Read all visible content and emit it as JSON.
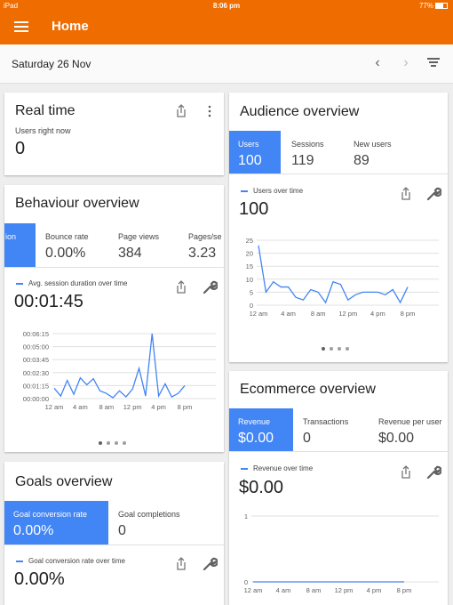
{
  "status_bar": {
    "device": "iPad",
    "time": "8:06 pm",
    "battery": "77%"
  },
  "app_bar": {
    "title": "Home"
  },
  "date_bar": {
    "date": "Saturday 26 Nov"
  },
  "realtime": {
    "title": "Real time",
    "label": "Users right now",
    "value": "0"
  },
  "behaviour": {
    "title": "Behaviour overview",
    "tabs": [
      {
        "label": "ion",
        "value": ""
      },
      {
        "label": "Bounce rate",
        "value": "0.00%"
      },
      {
        "label": "Page views",
        "value": "384"
      },
      {
        "label": "Pages/se",
        "value": "3.23"
      }
    ],
    "legend": "Avg. session duration over time",
    "big_value": "00:01:45",
    "chart_data": {
      "type": "line",
      "ylabels": [
        "00:06:15",
        "00:05:00",
        "00:03:45",
        "00:02:30",
        "00:01:15",
        "00:00:00"
      ],
      "yticks": [
        375,
        300,
        225,
        150,
        75,
        0
      ],
      "ylim": [
        0,
        375
      ],
      "xlabels": [
        "12 am",
        "4 am",
        "8 am",
        "12 pm",
        "4 pm",
        "8 pm"
      ],
      "x": [
        0,
        1,
        2,
        3,
        4,
        5,
        6,
        7,
        8,
        9,
        10,
        11,
        12,
        13,
        14,
        15,
        16,
        17,
        18,
        19,
        20
      ],
      "xticks": [
        0,
        4,
        8,
        12,
        16,
        20
      ],
      "values": [
        60,
        15,
        105,
        25,
        120,
        80,
        115,
        45,
        30,
        5,
        45,
        10,
        55,
        175,
        15,
        375,
        15,
        85,
        10,
        30,
        75
      ]
    }
  },
  "goals": {
    "title": "Goals overview",
    "tabs": [
      {
        "label": "Goal conversion rate",
        "value": "0.00%"
      },
      {
        "label": "Goal completions",
        "value": "0"
      }
    ],
    "legend": "Goal conversion rate over time",
    "big_value": "0.00%"
  },
  "audience": {
    "title": "Audience overview",
    "tabs": [
      {
        "label": "Users",
        "value": "100"
      },
      {
        "label": "Sessions",
        "value": "119"
      },
      {
        "label": "New users",
        "value": "89"
      }
    ],
    "legend": "Users over time",
    "big_value": "100",
    "chart_data": {
      "type": "line",
      "ylabels": [
        "25",
        "20",
        "15",
        "10",
        "5",
        "0"
      ],
      "yticks": [
        25,
        20,
        15,
        10,
        5,
        0
      ],
      "ylim": [
        0,
        25
      ],
      "xlabels": [
        "12 am",
        "4 am",
        "8 am",
        "12 pm",
        "4 pm",
        "8 pm"
      ],
      "x": [
        0,
        1,
        2,
        3,
        4,
        5,
        6,
        7,
        8,
        9,
        10,
        11,
        12,
        13,
        14,
        15,
        16,
        17,
        18,
        19,
        20
      ],
      "xticks": [
        0,
        4,
        8,
        12,
        16,
        20
      ],
      "values": [
        23,
        5,
        9,
        7,
        7,
        3,
        2,
        6,
        5,
        1,
        9,
        8,
        2,
        4,
        5,
        5,
        5,
        4,
        6,
        1,
        7
      ]
    }
  },
  "ecommerce": {
    "title": "Ecommerce overview",
    "tabs": [
      {
        "label": "Revenue",
        "value": "$0.00"
      },
      {
        "label": "Transactions",
        "value": "0"
      },
      {
        "label": "Revenue per user",
        "value": "$0.00"
      }
    ],
    "legend": "Revenue over time",
    "big_value": "$0.00",
    "chart_data": {
      "type": "line",
      "ylabels": [
        "1",
        "0"
      ],
      "yticks": [
        1,
        0
      ],
      "ylim": [
        0,
        1
      ],
      "xlabels": [
        "12 am",
        "4 am",
        "8 am",
        "12 pm",
        "4 pm",
        "8 pm"
      ],
      "x": [
        0,
        20
      ],
      "xticks": [
        0,
        4,
        8,
        12,
        16,
        20
      ],
      "values": [
        0,
        0
      ]
    }
  },
  "colors": {
    "brand": "#ef6c00",
    "accent": "#4285f4"
  },
  "icons": [
    "menu-icon",
    "chevron-left-icon",
    "chevron-right-icon",
    "filter-icon",
    "share-icon",
    "more-vert-icon",
    "wrench-icon"
  ]
}
